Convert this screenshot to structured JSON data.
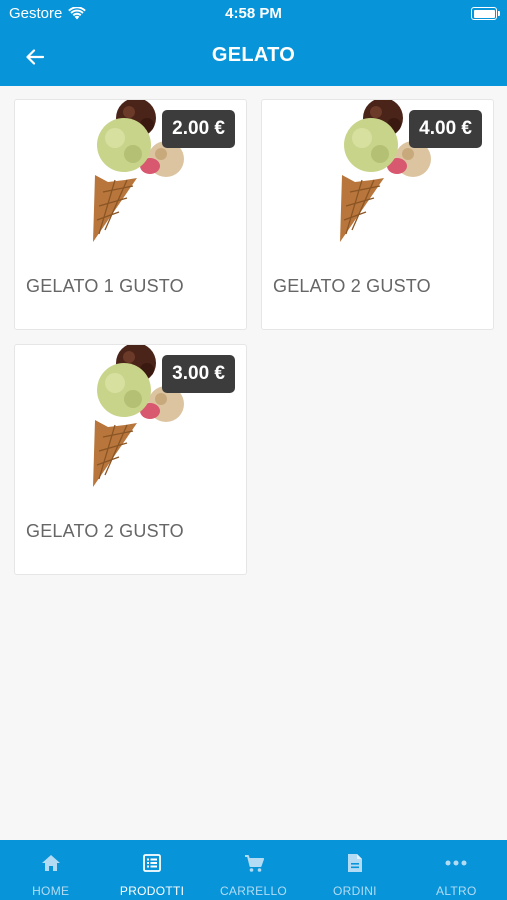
{
  "status": {
    "carrier": "Gestore",
    "time": "4:58 PM"
  },
  "header": {
    "title": "GELATO"
  },
  "products": [
    {
      "name": "GELATO 1 GUSTO",
      "price": "2.00 €"
    },
    {
      "name": "GELATO 2 GUSTO",
      "price": "4.00 €"
    },
    {
      "name": "GELATO 2 GUSTO",
      "price": "3.00 €"
    }
  ],
  "tabs": [
    {
      "label": "HOME",
      "icon": "home-icon"
    },
    {
      "label": "PRODOTTI",
      "icon": "list-icon"
    },
    {
      "label": "CARRELLO",
      "icon": "cart-icon"
    },
    {
      "label": "ORDINI",
      "icon": "document-icon"
    },
    {
      "label": "ALTRO",
      "icon": "more-icon"
    }
  ],
  "active_tab": "PRODOTTI",
  "colors": {
    "primary": "#0894d8",
    "badge": "#3c3c3c",
    "tab_inactive": "#b3dcf4"
  }
}
